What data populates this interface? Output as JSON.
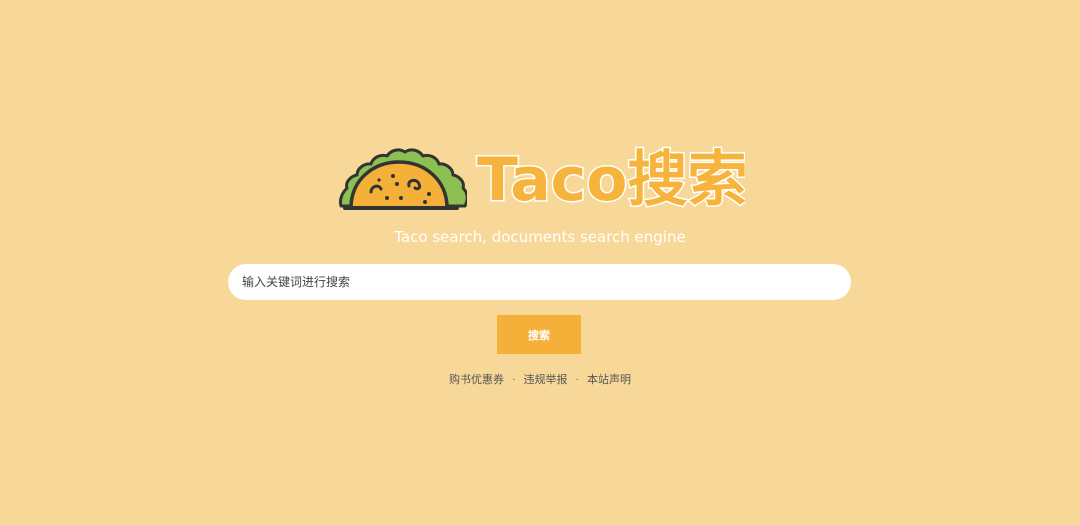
{
  "brand": {
    "name": "Taco搜索",
    "tagline": "Taco search, documents search engine",
    "logo_icon": "taco-icon"
  },
  "search": {
    "placeholder": "输入关键词进行搜索",
    "value": "",
    "button_label": "搜索"
  },
  "footer": {
    "links": [
      {
        "label": "购书优惠券"
      },
      {
        "label": "违规举报"
      },
      {
        "label": "本站声明"
      }
    ],
    "separator": "·"
  },
  "colors": {
    "background": "#f8d898",
    "accent": "#f5b03a",
    "brand_text": "#f6b43c",
    "tagline": "#ffffff",
    "taco_lettuce": "#8cc152",
    "taco_shell": "#f5b03a",
    "outline": "#333333"
  }
}
